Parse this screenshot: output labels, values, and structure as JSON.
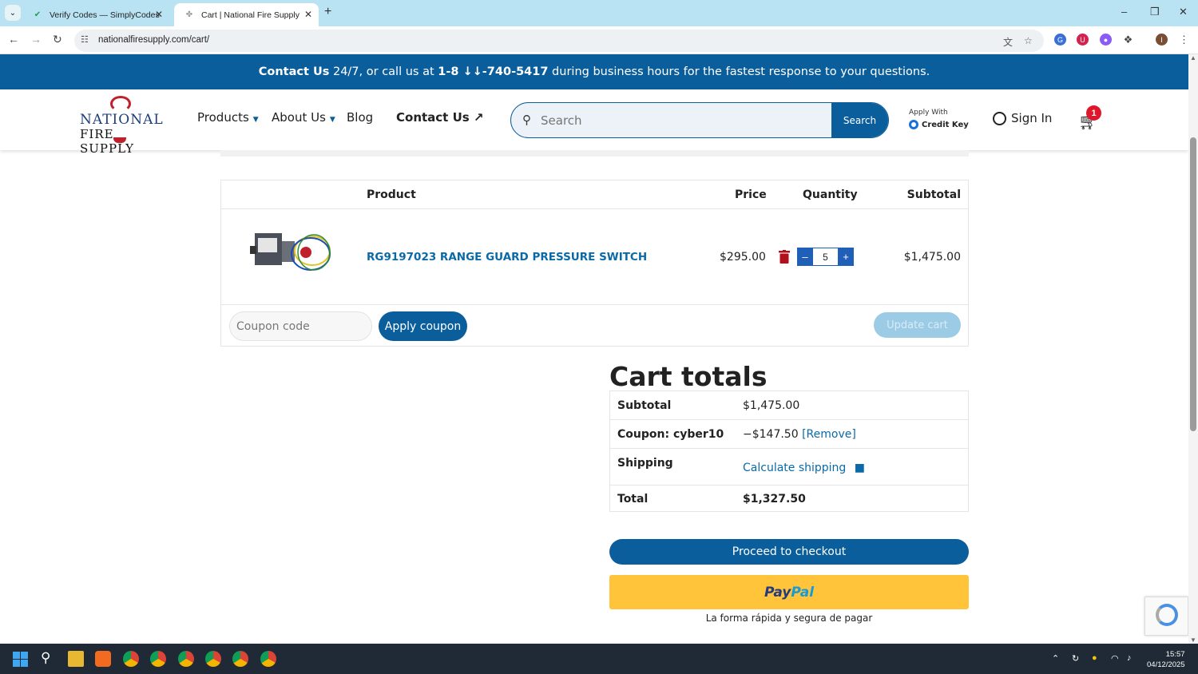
{
  "browser": {
    "tabs": [
      {
        "title": "Verify Codes — SimplyCodes",
        "active": false
      },
      {
        "title": "Cart | National Fire Supply",
        "active": true
      }
    ],
    "url": "nationalfiresupply.com/cart/"
  },
  "announcement": {
    "contact_bold": "Contact Us",
    "text1": " 24/7, or call us at ",
    "phone": "1-8 ↓↓-740-5417",
    "text2": " during business hours for the fastest response to your questions."
  },
  "header": {
    "logo_line1": "NATIONAL",
    "logo_line2": "FIRE SUPPLY",
    "nav": {
      "products": "Products",
      "about": "About Us",
      "blog": "Blog",
      "contact": "Contact Us"
    },
    "search_placeholder": "Search",
    "search_button": "Search",
    "apply_with": "Apply With",
    "credit_key": "Credit Key",
    "sign_in": "Sign In",
    "cart_count": "1"
  },
  "cart": {
    "headers": {
      "product": "Product",
      "price": "Price",
      "quantity": "Quantity",
      "subtotal": "Subtotal"
    },
    "item": {
      "name": "RG9197023 RANGE GUARD PRESSURE SWITCH",
      "price": "$295.00",
      "quantity": "5",
      "subtotal": "$1,475.00"
    },
    "coupon_placeholder": "Coupon code",
    "apply_coupon": "Apply coupon",
    "update_cart": "Update cart"
  },
  "totals": {
    "title": "Cart totals",
    "subtotal_label": "Subtotal",
    "subtotal_value": "$1,475.00",
    "coupon_label": "Coupon: cyber10",
    "coupon_value": "−$147.50",
    "coupon_remove": "[Remove]",
    "shipping_label": "Shipping",
    "shipping_link": "Calculate shipping",
    "total_label": "Total",
    "total_value": "$1,327.50",
    "checkout": "Proceed to checkout",
    "paypal_1": "Pay",
    "paypal_2": "Pal",
    "paypal_tagline": "La forma rápida y segura de pagar"
  },
  "taskbar": {
    "time": "15:57",
    "date": "04/12/2025"
  },
  "colors": {
    "brand_blue": "#0a5e9c",
    "link_blue": "#0a6aa8",
    "paypal_yellow": "#ffc439",
    "badge_red": "#e0162b"
  }
}
